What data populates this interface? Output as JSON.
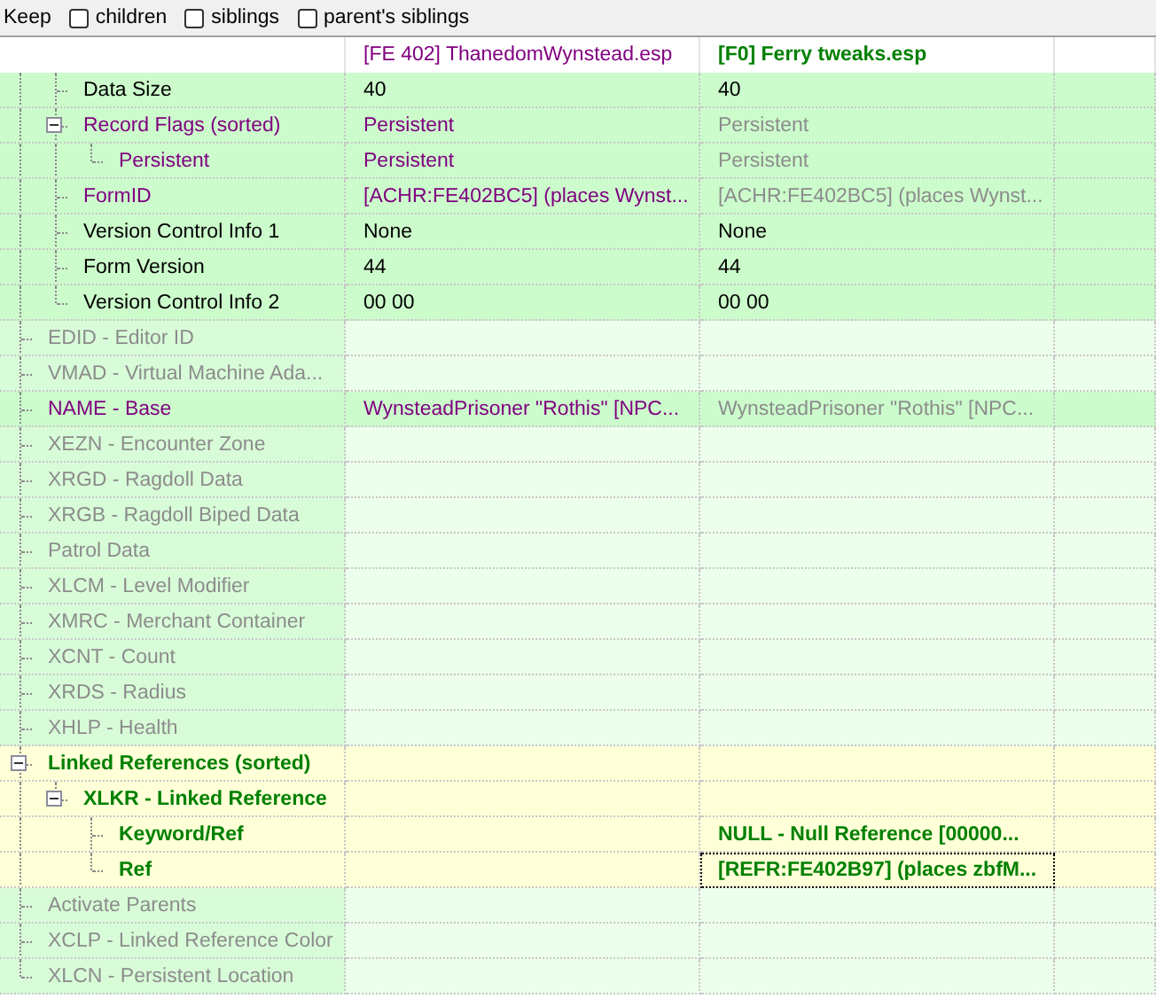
{
  "toolbar": {
    "label": "Keep",
    "options": [
      {
        "label": "children",
        "checked": false
      },
      {
        "label": "siblings",
        "checked": false
      },
      {
        "label": "parent's siblings",
        "checked": false
      }
    ]
  },
  "header": [
    {
      "text": "[FE 402] ThanedomWynstead.esp",
      "kind": "modified"
    },
    {
      "text": "[F0] Ferry tweaks.esp",
      "kind": "winning"
    }
  ],
  "tree": [
    {
      "children": [
        {
          "label": "Data Size",
          "kind": "normal",
          "color": "#ccfccc",
          "cells": [
            {
              "text": "40",
              "kind": "normal",
              "focused": false
            },
            {
              "text": "40",
              "kind": "normal",
              "focused": false
            }
          ]
        },
        {
          "label": "Record Flags (sorted)",
          "kind": "modified",
          "color": "#ccfccc",
          "expanded": true,
          "cells": [
            {
              "text": "Persistent",
              "kind": "modified",
              "focused": false
            },
            {
              "text": "Persistent",
              "kind": "faded",
              "focused": false
            }
          ],
          "children": [
            {
              "label": "Persistent",
              "kind": "modified",
              "color": "#ccfccc",
              "cells": [
                {
                  "text": "Persistent",
                  "kind": "modified",
                  "focused": false
                },
                {
                  "text": "Persistent",
                  "kind": "faded",
                  "focused": false
                }
              ]
            }
          ]
        },
        {
          "label": "FormID",
          "kind": "modified",
          "color": "#ccfccc",
          "cells": [
            {
              "text": "[ACHR:FE402BC5] (places Wynst...",
              "kind": "modified",
              "focused": false
            },
            {
              "text": "[ACHR:FE402BC5] (places Wynst...",
              "kind": "faded",
              "focused": false
            }
          ]
        },
        {
          "label": "Version Control Info 1",
          "kind": "normal",
          "color": "#ccfccc",
          "cells": [
            {
              "text": "None",
              "kind": "normal",
              "focused": false
            },
            {
              "text": "None",
              "kind": "normal",
              "focused": false
            }
          ]
        },
        {
          "label": "Form Version",
          "kind": "normal",
          "color": "#ccfccc",
          "cells": [
            {
              "text": "44",
              "kind": "normal",
              "focused": false
            },
            {
              "text": "44",
              "kind": "normal",
              "focused": false
            }
          ]
        },
        {
          "label": "Version Control Info 2",
          "kind": "normal",
          "color": "#ccfccc",
          "cells": [
            {
              "text": "00 00",
              "kind": "normal",
              "focused": false
            },
            {
              "text": "00 00",
              "kind": "normal",
              "focused": false
            }
          ]
        }
      ]
    },
    {
      "label": "EDID - Editor ID",
      "kind": "faded",
      "color": "#d8fcd8"
    },
    {
      "label": "VMAD - Virtual Machine Ada...",
      "kind": "faded",
      "color": "#d8fcd8"
    },
    {
      "label": "NAME - Base",
      "kind": "modified",
      "color": "#ccfccc",
      "cells": [
        {
          "text": "WynsteadPrisoner \"Rothis\" [NPC...",
          "kind": "modified",
          "focused": false
        },
        {
          "text": "WynsteadPrisoner \"Rothis\" [NPC...",
          "kind": "faded",
          "focused": false
        }
      ]
    },
    {
      "label": "XEZN - Encounter Zone",
      "kind": "faded",
      "color": "#d8fcd8"
    },
    {
      "label": "XRGD - Ragdoll Data",
      "kind": "faded",
      "color": "#d8fcd8"
    },
    {
      "label": "XRGB - Ragdoll Biped Data",
      "kind": "faded",
      "color": "#d8fcd8"
    },
    {
      "label": "Patrol Data",
      "kind": "faded",
      "color": "#d8fcd8"
    },
    {
      "label": "XLCM - Level Modifier",
      "kind": "faded",
      "color": "#d8fcd8"
    },
    {
      "label": "XMRC - Merchant Container",
      "kind": "faded",
      "color": "#d8fcd8"
    },
    {
      "label": "XCNT - Count",
      "kind": "faded",
      "color": "#d8fcd8"
    },
    {
      "label": "XRDS - Radius",
      "kind": "faded",
      "color": "#d8fcd8"
    },
    {
      "label": "XHLP - Health",
      "kind": "faded",
      "color": "#d8fcd8"
    },
    {
      "label": "Linked References (sorted)",
      "kind": "winning",
      "color": "#ffffd8",
      "expanded": true,
      "children": [
        {
          "label": "XLKR - Linked Reference",
          "kind": "winning",
          "color": "#ffffd8",
          "expanded": true,
          "children": [
            {
              "label": "Keyword/Ref",
              "kind": "winning",
              "color": "#ffffd8",
              "cells": [
                null,
                {
                  "text": "NULL - Null Reference [00000...",
                  "kind": "winning",
                  "focused": false
                }
              ]
            },
            {
              "label": "Ref",
              "kind": "winning",
              "color": "#ffffd8",
              "cells": [
                null,
                {
                  "text": "[REFR:FE402B97] (places zbfM...",
                  "kind": "winning",
                  "focused": true
                }
              ]
            }
          ]
        }
      ]
    },
    {
      "label": "Activate Parents",
      "kind": "faded",
      "color": "#d8fcd8"
    },
    {
      "label": "XCLP - Linked Reference Color",
      "kind": "faded",
      "color": "#d8fcd8"
    },
    {
      "label": "XLCN - Persistent Location",
      "kind": "faded",
      "color": "#d8fcd8"
    }
  ]
}
